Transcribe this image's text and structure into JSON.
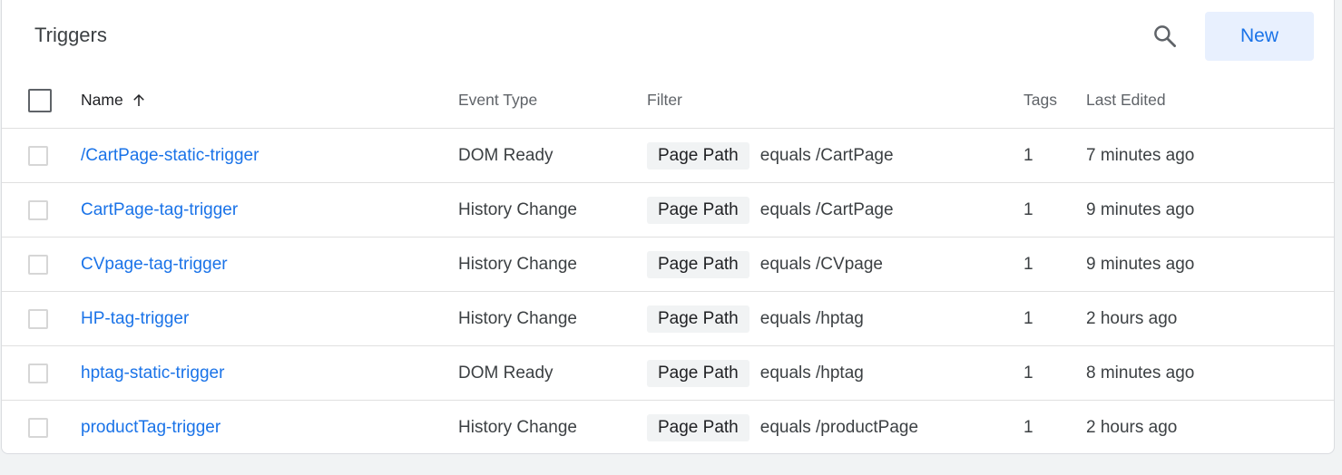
{
  "header": {
    "title": "Triggers",
    "search_icon": "search-icon",
    "new_label": "New"
  },
  "columns": {
    "name": "Name",
    "event_type": "Event Type",
    "filter": "Filter",
    "tags": "Tags",
    "last_edited": "Last Edited",
    "sort_icon": "arrow-up-icon"
  },
  "rows": [
    {
      "name": "/CartPage-static-trigger",
      "event_type": "DOM Ready",
      "filter_chip": "Page Path",
      "filter_text": "equals /CartPage",
      "tags": "1",
      "last_edited": "7 minutes ago"
    },
    {
      "name": "CartPage-tag-trigger",
      "event_type": "History Change",
      "filter_chip": "Page Path",
      "filter_text": "equals /CartPage",
      "tags": "1",
      "last_edited": "9 minutes ago"
    },
    {
      "name": "CVpage-tag-trigger",
      "event_type": "History Change",
      "filter_chip": "Page Path",
      "filter_text": "equals /CVpage",
      "tags": "1",
      "last_edited": "9 minutes ago"
    },
    {
      "name": "HP-tag-trigger",
      "event_type": "History Change",
      "filter_chip": "Page Path",
      "filter_text": "equals /hptag",
      "tags": "1",
      "last_edited": "2 hours ago"
    },
    {
      "name": "hptag-static-trigger",
      "event_type": "DOM Ready",
      "filter_chip": "Page Path",
      "filter_text": "equals /hptag",
      "tags": "1",
      "last_edited": "8 minutes ago"
    },
    {
      "name": "productTag-trigger",
      "event_type": "History Change",
      "filter_chip": "Page Path",
      "filter_text": "equals /productPage",
      "tags": "1",
      "last_edited": "2 hours ago"
    }
  ],
  "colors": {
    "link": "#1a73e8",
    "new_button_bg": "#e8f0fe",
    "chip_bg": "#f1f3f4"
  }
}
